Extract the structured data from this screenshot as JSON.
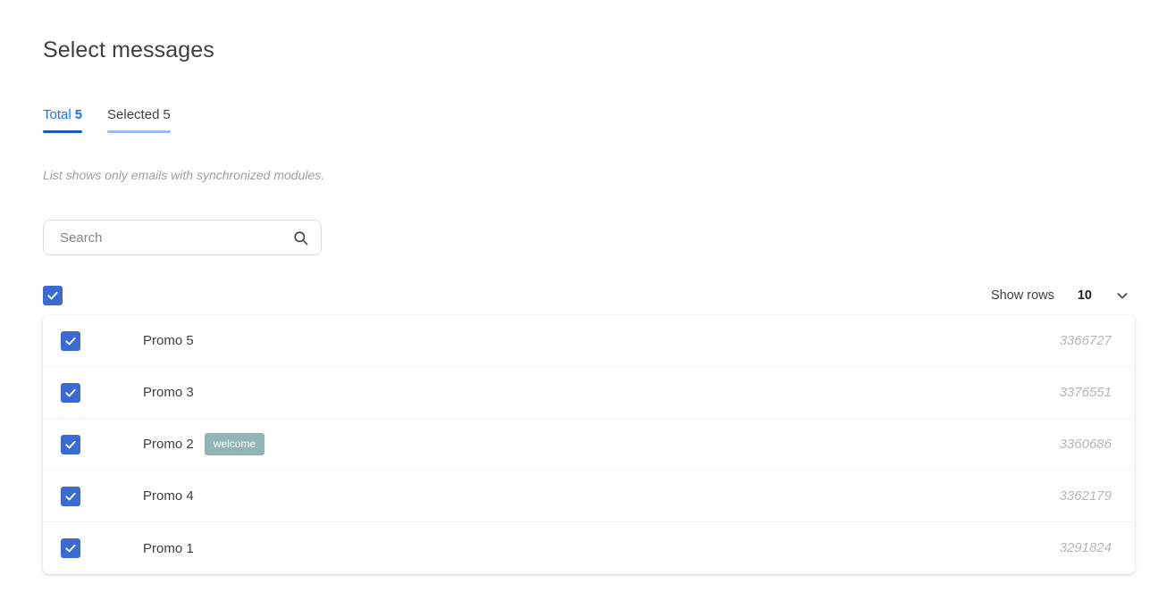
{
  "page": {
    "title": "Select messages"
  },
  "tabs": [
    {
      "label": "Total",
      "count": "5",
      "active": true
    },
    {
      "label": "Selected",
      "count": "5",
      "active": false
    }
  ],
  "hint": "List shows only emails with synchronized modules.",
  "search": {
    "placeholder": "Search",
    "value": "",
    "icon": "search-icon"
  },
  "toolbar": {
    "select_all_checked": true,
    "show_rows_label": "Show rows",
    "show_rows_value": "10",
    "chevron_icon": "chevron-down-icon"
  },
  "table": {
    "rows": [
      {
        "checked": true,
        "name": "Promo 5",
        "badge": "",
        "id": "3366727"
      },
      {
        "checked": true,
        "name": "Promo 3",
        "badge": "",
        "id": "3376551"
      },
      {
        "checked": true,
        "name": "Promo 2",
        "badge": "welcome",
        "id": "3360686"
      },
      {
        "checked": true,
        "name": "Promo 4",
        "badge": "",
        "id": "3362179"
      },
      {
        "checked": true,
        "name": "Promo 1",
        "badge": "",
        "id": "3291824"
      }
    ]
  },
  "colors": {
    "accent_blue": "#1a73e8",
    "active_tab_underline": "#1a56c4",
    "inactive_tab_underline": "#9dbaf0",
    "checkbox_blue": "#3b6ad1",
    "badge_teal": "#91b5b7",
    "text_primary": "#3c4043",
    "text_muted": "#9aa0a6",
    "id_gray": "#b3b6ba",
    "row_divider": "#f1f3f4",
    "field_border": "#dadce0",
    "background": "#ffffff"
  }
}
